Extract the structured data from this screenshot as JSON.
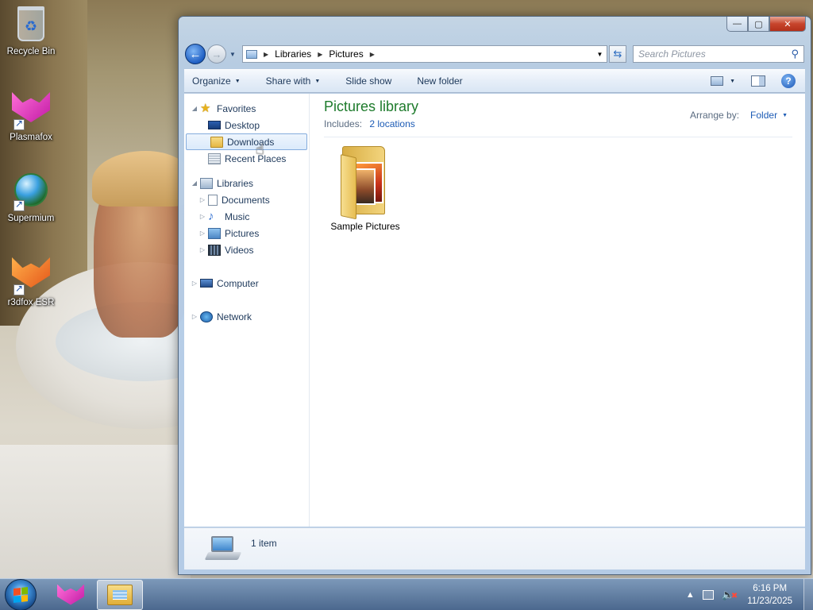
{
  "desktop": {
    "icons": [
      {
        "label": "Recycle Bin",
        "icon": "recycle-bin-icon"
      },
      {
        "label": "Plasmafox",
        "icon": "plasmafox-icon"
      },
      {
        "label": "Supermium",
        "icon": "supermium-icon"
      },
      {
        "label": "r3dfox ESR",
        "icon": "r3dfox-icon"
      }
    ]
  },
  "window": {
    "caption": {
      "minimize": "—",
      "maximize": "▢",
      "close": "✕"
    },
    "nav": {
      "back": "←",
      "forward": "→"
    },
    "address": {
      "crumbs": [
        "Libraries",
        "Pictures"
      ]
    },
    "search": {
      "placeholder": "Search Pictures"
    },
    "toolbar": {
      "organize": "Organize",
      "share_with": "Share with",
      "slide_show": "Slide show",
      "new_folder": "New folder",
      "help": "?"
    },
    "nav_pane": {
      "favorites": {
        "label": "Favorites",
        "items": [
          "Desktop",
          "Downloads",
          "Recent Places"
        ]
      },
      "libraries": {
        "label": "Libraries",
        "items": [
          "Documents",
          "Music",
          "Pictures",
          "Videos"
        ]
      },
      "computer": "Computer",
      "network": "Network",
      "selected": "Downloads"
    },
    "content": {
      "title": "Pictures library",
      "includes_label": "Includes:",
      "includes_link": "2 locations",
      "arrange_label": "Arrange by:",
      "arrange_value": "Folder",
      "items": [
        {
          "label": "Sample Pictures",
          "icon": "folder-icon"
        }
      ]
    },
    "details": {
      "count": "1 item"
    }
  },
  "taskbar": {
    "pinned": [
      {
        "name": "plasmafox",
        "active": false
      },
      {
        "name": "windows-explorer",
        "active": true
      }
    ],
    "clock": {
      "time": "6:16 PM",
      "date": "11/23/2025"
    },
    "volume_muted": true
  },
  "colors": {
    "library_title": "#1e7b2c",
    "link": "#1c5bb5",
    "selection": "#84acdd"
  }
}
